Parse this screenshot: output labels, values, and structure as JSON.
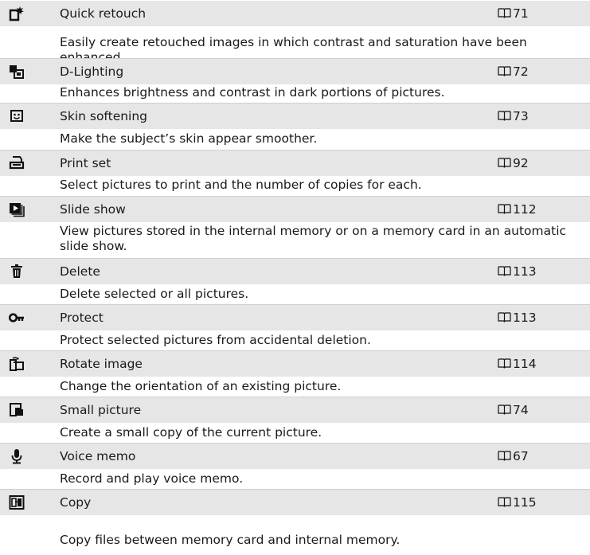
{
  "items": [
    {
      "icon": "quick-retouch-icon",
      "title": "Quick retouch",
      "page": "71",
      "description": "Easily create retouched images in which contrast and saturation have been enhanced."
    },
    {
      "icon": "d-lighting-icon",
      "title": "D-Lighting",
      "page": "72",
      "description": "Enhances brightness and contrast in dark portions of pictures."
    },
    {
      "icon": "skin-softening-icon",
      "title": "Skin softening",
      "page": "73",
      "description": "Make the subject’s skin appear smoother."
    },
    {
      "icon": "print-set-icon",
      "title": "Print set",
      "page": "92",
      "description": "Select pictures to print and the number of copies for each."
    },
    {
      "icon": "slide-show-icon",
      "title": "Slide show",
      "page": "112",
      "description": "View pictures stored in the internal memory or on a memory card in an automatic slide show."
    },
    {
      "icon": "delete-icon",
      "title": "Delete",
      "page": "113",
      "description": "Delete selected or all pictures."
    },
    {
      "icon": "protect-icon",
      "title": "Protect",
      "page": "113",
      "description": "Protect selected pictures from accidental deletion."
    },
    {
      "icon": "rotate-image-icon",
      "title": "Rotate image",
      "page": "114",
      "description": "Change the orientation of an existing picture."
    },
    {
      "icon": "small-picture-icon",
      "title": "Small picture",
      "page": "74",
      "description": "Create a small copy of the current picture."
    },
    {
      "icon": "voice-memo-icon",
      "title": "Voice memo",
      "page": "67",
      "description": "Record and play voice memo."
    },
    {
      "icon": "copy-icon",
      "title": "Copy",
      "page": "115",
      "description": "Copy files between memory card and internal memory."
    }
  ]
}
